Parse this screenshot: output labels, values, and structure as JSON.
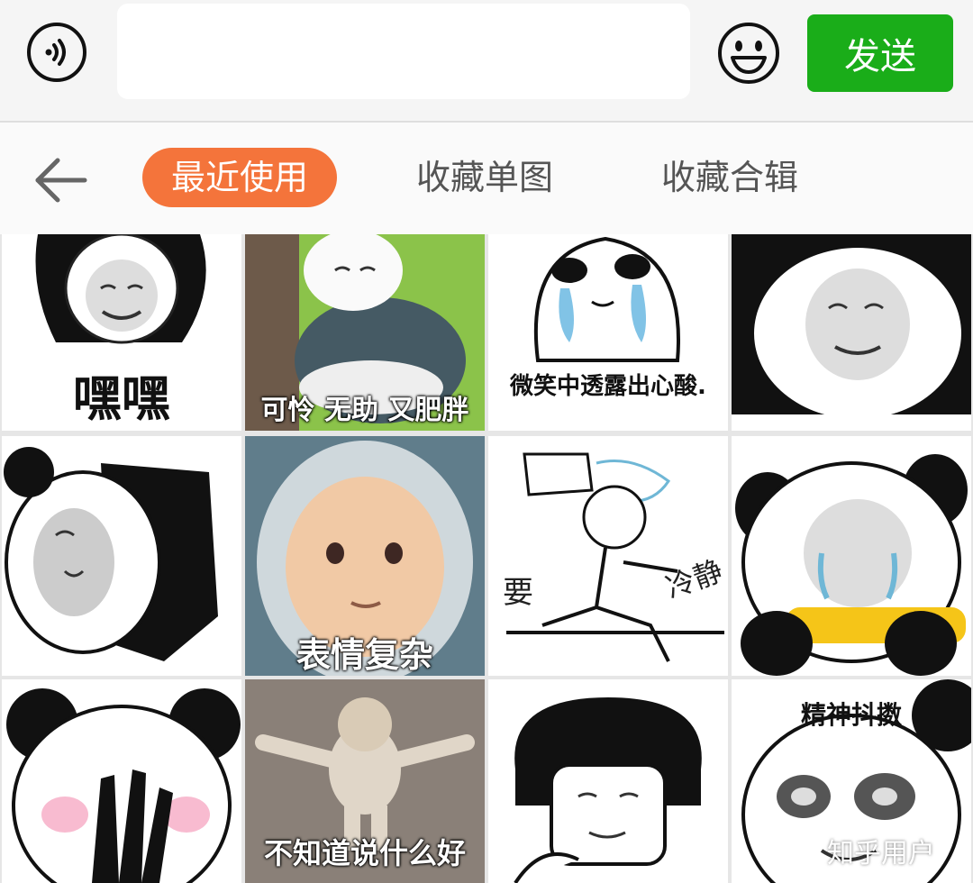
{
  "input_bar": {
    "voice_icon": "voice-icon",
    "message_value": "",
    "emoji_icon": "smiley-icon",
    "send_label": "发送",
    "accent": "#1aad19"
  },
  "tabs": {
    "back_icon": "back-arrow-icon",
    "items": [
      {
        "label": "最近使用",
        "active": true
      },
      {
        "label": "收藏单图",
        "active": false
      },
      {
        "label": "收藏合辑",
        "active": false
      }
    ],
    "active_color": "#f4743b"
  },
  "stickers": [
    {
      "caption": "嘿嘿"
    },
    {
      "caption": "可怜 无助 又肥胖"
    },
    {
      "caption": "微笑中透露出心酸."
    },
    {
      "caption": ""
    },
    {
      "caption": ""
    },
    {
      "caption": "表情复杂"
    },
    {
      "caption": "要",
      "caption2": "冷静"
    },
    {
      "caption": ""
    },
    {
      "caption": ""
    },
    {
      "caption": "不知道说什么好"
    },
    {
      "caption": ""
    },
    {
      "caption": "精神抖擞"
    }
  ],
  "watermark": "知乎用户"
}
